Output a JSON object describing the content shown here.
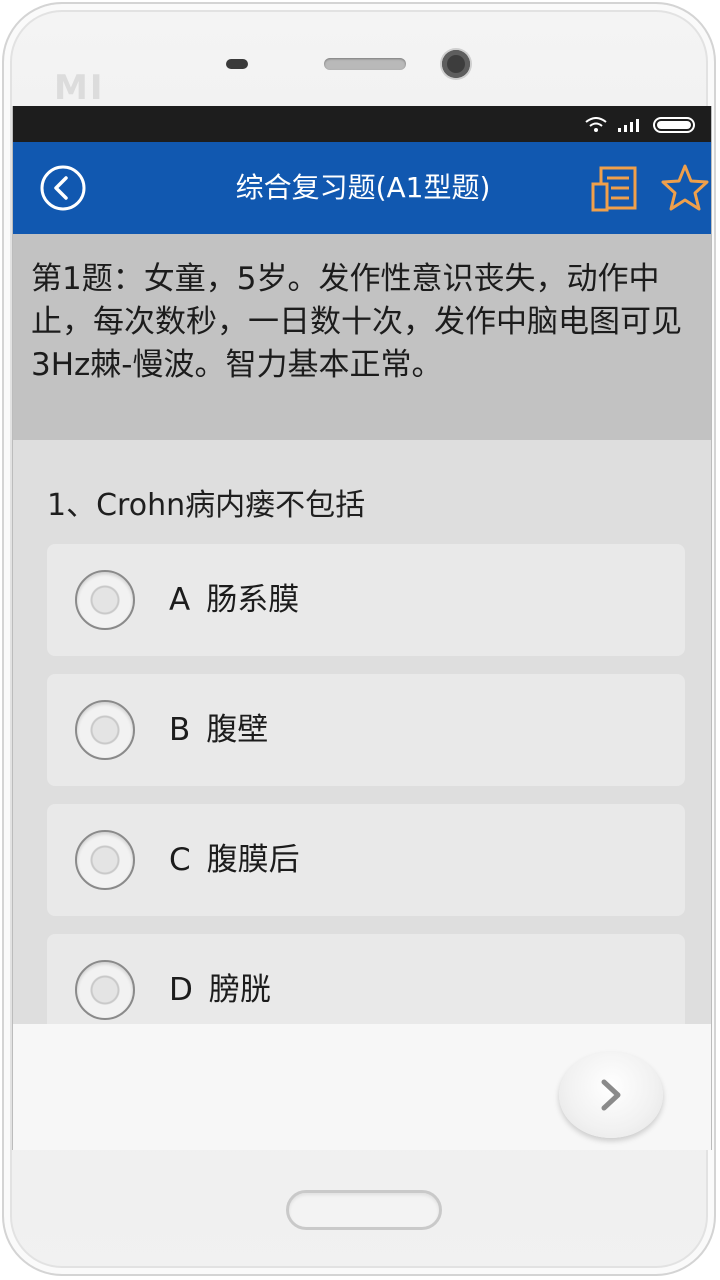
{
  "device": {
    "brand_logo": "MI"
  },
  "app_bar": {
    "title": "综合复习题(A1型题)",
    "back_icon": "back-circle-icon",
    "notes_icon": "notes-icon",
    "favorite_icon": "star-icon",
    "color": "#1158b0"
  },
  "stem": {
    "text": "第1题：女童，5岁。发作性意识丧失，动作中止，每次数秒，一日数十次，发作中脑电图可见3Hz棘-慢波。智力基本正常。"
  },
  "question": {
    "text": "1、Crohn病内瘘不包括",
    "options": [
      {
        "letter": "A",
        "text": "肠系膜"
      },
      {
        "letter": "B",
        "text": "腹壁"
      },
      {
        "letter": "C",
        "text": "腹膜后"
      },
      {
        "letter": "D",
        "text": "膀胱"
      }
    ]
  },
  "bottom_bar": {
    "next_icon": "chevron-right-icon"
  }
}
